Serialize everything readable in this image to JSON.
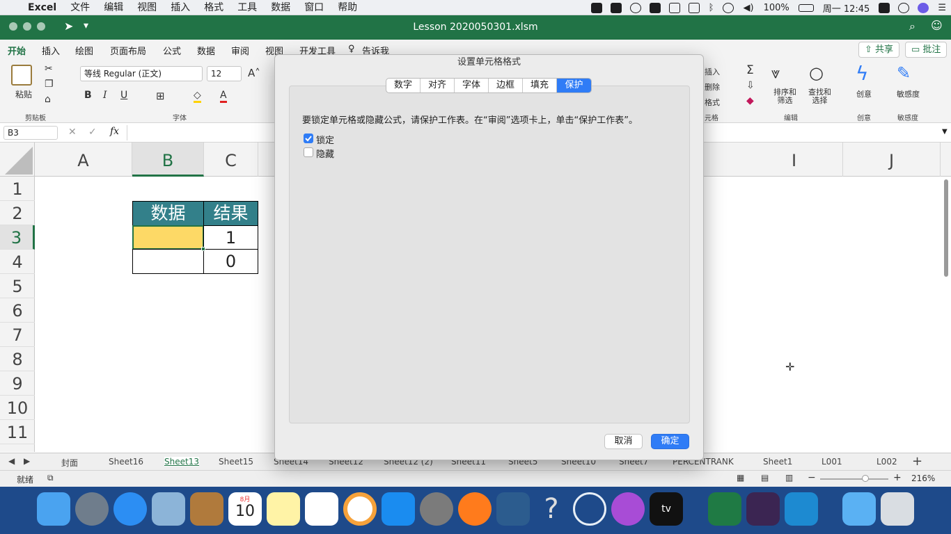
{
  "menubar": {
    "app_name": "Excel",
    "items": [
      "文件",
      "编辑",
      "视图",
      "插入",
      "格式",
      "工具",
      "数据",
      "窗口",
      "帮助"
    ],
    "battery": "100%",
    "clock": "周一 12:45"
  },
  "window": {
    "title": "Lesson 2020050301.xlsm"
  },
  "ribbon_tabs": [
    "开始",
    "插入",
    "绘图",
    "页面布局",
    "公式",
    "数据",
    "审阅",
    "视图",
    "开发工具"
  ],
  "tell_me": "告诉我",
  "share_label": "共享",
  "comments_label": "批注",
  "ribbon": {
    "paste": "粘贴",
    "clipboard_group": "剪贴板",
    "font_name": "等线 Regular (正文)",
    "font_size": "12",
    "font_group": "字体",
    "bold": "B",
    "italic": "I",
    "underline": "U",
    "insert": "插入",
    "delete": "删除",
    "format": "格式",
    "cells_group": "元格",
    "sort_filter": [
      "排序和",
      "筛选"
    ],
    "find_select": [
      "查找和",
      "选择"
    ],
    "edit_group": "编辑",
    "ideas": "创意",
    "ideas_group": "创意",
    "sensitivity": "敏感度",
    "sensitivity_group": "敏感度"
  },
  "formula_bar": {
    "name_box": "B3",
    "fx": "fx"
  },
  "columns": [
    "A",
    "B",
    "C",
    "I",
    "J"
  ],
  "rows": [
    "1",
    "2",
    "3",
    "4",
    "5",
    "6",
    "7",
    "8",
    "9",
    "10",
    "11"
  ],
  "table": {
    "headers": [
      "数据",
      "结果"
    ],
    "rows": [
      [
        "",
        "1"
      ],
      [
        "",
        "0"
      ]
    ],
    "header_color": "#33808a",
    "selected_fill": "#fdd966"
  },
  "sheet_tabs": [
    "封面",
    "Sheet16",
    "Sheet13",
    "Sheet15",
    "Sheet14",
    "Sheet12",
    "Sheet12 (2)",
    "Sheet11",
    "Sheet5",
    "Sheet10",
    "Sheet7",
    "PERCENTRANK",
    "Sheet1",
    "L001",
    "L002"
  ],
  "active_sheet": "Sheet13",
  "status": {
    "mode": "就绪",
    "zoom": "216%"
  },
  "dialog": {
    "title": "设置单元格格式",
    "tabs": [
      "数字",
      "对齐",
      "字体",
      "边框",
      "填充",
      "保护"
    ],
    "active_tab": "保护",
    "message": "要锁定单元格或隐藏公式，请保护工作表。在“审阅”选项卡上，单击“保护工作表”。",
    "locked_label": "锁定",
    "locked_checked": true,
    "hidden_label": "隐藏",
    "hidden_checked": false,
    "cancel": "取消",
    "ok": "确定"
  },
  "dock": {
    "calendar_month": "8月",
    "calendar_day": "10",
    "tv_label": "tv"
  }
}
